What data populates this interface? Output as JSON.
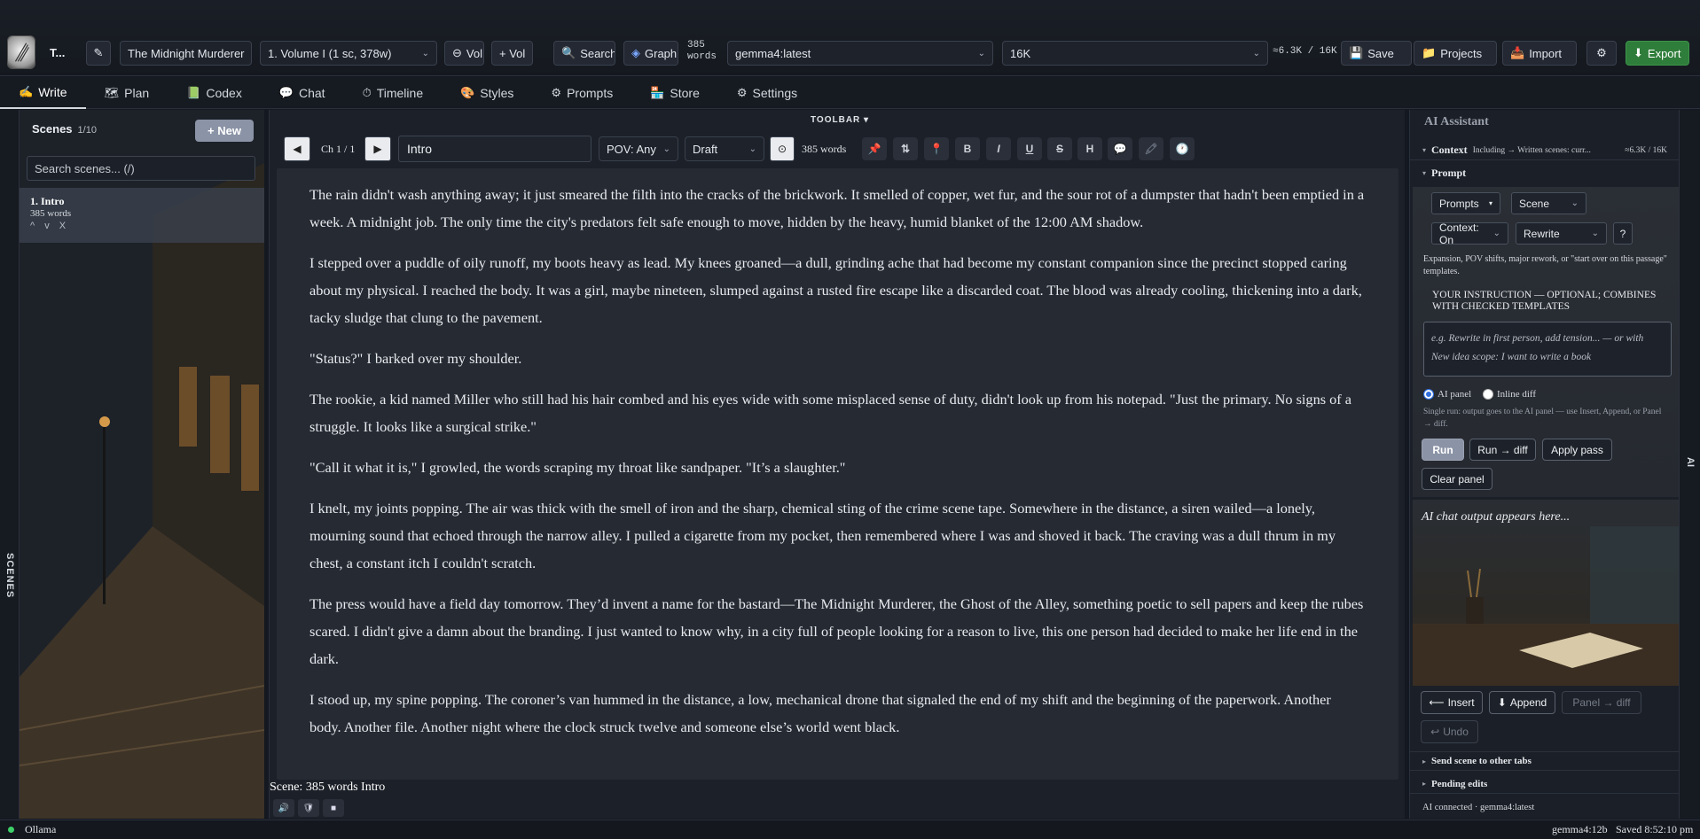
{
  "app": {
    "short_title": "T..."
  },
  "toolbar": {
    "project": "The Midnight Murderer",
    "volume": "1. Volume I (1 sc, 378w)",
    "vol_minus": "Vol",
    "vol_plus": "+ Vol",
    "search": "Search",
    "graph": "Graph",
    "word_count_number": "385",
    "word_count_unit": "words",
    "model": "gemma4:latest",
    "context_size": "16K",
    "token_usage": "≈6.3K / 16K",
    "save": "Save",
    "projects": "Projects",
    "import": "Import",
    "export": "Export"
  },
  "nav": {
    "tabs": [
      {
        "label": "Write",
        "icon": "✍"
      },
      {
        "label": "Plan",
        "icon": "🗺"
      },
      {
        "label": "Codex",
        "icon": "📗"
      },
      {
        "label": "Chat",
        "icon": "💬"
      },
      {
        "label": "Timeline",
        "icon": "⏱"
      },
      {
        "label": "Styles",
        "icon": "🎨"
      },
      {
        "label": "Prompts",
        "icon": "⚙"
      },
      {
        "label": "Store",
        "icon": "🏪"
      },
      {
        "label": "Settings",
        "icon": "⚙"
      }
    ]
  },
  "scenes": {
    "rail_label": "SCENES",
    "title": "Scenes",
    "count": "1/10",
    "new_button": "+ New",
    "search_placeholder": "Search scenes... (/)",
    "items": [
      {
        "title": "1. Intro",
        "words": "385 words",
        "controls": "^ v X"
      }
    ]
  },
  "editor": {
    "toolbar_label": "TOOLBAR ▾",
    "chapter": "Ch 1 / 1",
    "scene_title": "Intro",
    "pov": "POV: Any",
    "status": "Draft",
    "word_count": "385 words",
    "format_buttons": [
      "B",
      "I",
      "U",
      "S",
      "H"
    ],
    "paragraphs": [
      "The rain didn't wash anything away; it just smeared the filth into the cracks of the brickwork. It smelled of copper, wet fur, and the sour rot of a dumpster that hadn't been emptied in a week. A midnight job. The only time the city's predators felt safe enough to move, hidden by the heavy, humid blanket of the 12:00 AM shadow.",
      "I stepped over a puddle of oily runoff, my boots heavy as lead. My knees groaned—a dull, grinding ache that had become my constant companion since the precinct stopped caring about my physical. I reached the body. It was a girl, maybe nineteen, slumped against a rusted fire escape like a discarded coat. The blood was already cooling, thickening into a dark, tacky sludge that clung to the pavement.",
      "\"Status?\" I barked over my shoulder.",
      "The rookie, a kid named Miller who still had his hair combed and his eyes wide with some misplaced sense of duty, didn't look up from his notepad. \"Just the primary. No signs of a struggle. It looks like a surgical strike.\"",
      "\"Call it what it is,\" I growled, the words scraping my throat like sandpaper. \"It’s a slaughter.\"",
      "I knelt, my joints popping. The air was thick with the smell of iron and the sharp, chemical sting of the crime scene tape. Somewhere in the distance, a siren wailed—a lonely, mourning sound that echoed through the narrow alley. I pulled a cigarette from my pocket, then remembered where I was and shoved it back. The craving was a dull thrum in my chest, a constant itch I couldn't scratch.",
      "The press would have a field day tomorrow. They’d invent a name for the bastard—The Midnight Murderer, the Ghost of the Alley, something poetic to sell papers and keep the rubes scared. I didn't give a damn about the branding. I just wanted to know why, in a city full of people looking for a reason to live, this one person had decided to make her life end in the dark.",
      "I stood up, my spine popping. The coroner’s van hummed in the distance, a low, mechanical drone that signaled the end of my shift and the beginning of the paperwork. Another body. Another file. Another night where the clock struck twelve and someone else’s world went black."
    ],
    "status_line": "Scene: 385 words Intro"
  },
  "ai": {
    "rail_label": "AI",
    "title": "AI Assistant",
    "context_label": "Context",
    "context_detail": "Including → Written scenes: curr...",
    "context_usage": "≈6.3K / 16K",
    "prompt_label": "Prompt",
    "prompts_select": "Prompts",
    "scene_select": "Scene",
    "context_select": "Context: On",
    "mode_select": "Rewrite",
    "help": "?",
    "template_note": "Expansion, POV shifts, major rework, or \"start over on this passage\" templates.",
    "instruction_label": "YOUR INSTRUCTION — OPTIONAL; COMBINES WITH CHECKED TEMPLATES",
    "instruction_placeholder": "e.g. Rewrite in first person, add tension... — or with New idea scope: I want to write a book",
    "radio_panel": "AI panel",
    "radio_inline": "Inline diff",
    "run_note": "Single run: output goes to the AI panel — use Insert, Append, or Panel → diff.",
    "run": "Run",
    "run_diff": "Run → diff",
    "apply_pass": "Apply pass",
    "clear_panel": "Clear panel",
    "output_placeholder": "AI chat output appears here...",
    "insert": "Insert",
    "append": "Append",
    "panel_diff": "Panel → diff",
    "undo": "Undo",
    "send_scene": "Send scene to other tabs",
    "pending": "Pending edits",
    "connected": "AI connected · gemma4:latest"
  },
  "statusbar": {
    "provider": "Ollama",
    "model": "gemma4:12b",
    "saved": "Saved 8:52:10 pm"
  },
  "colors": {
    "accent_green": "#2f7d3a",
    "status_dot": "#3ed169",
    "run_button": "#8b93a6"
  }
}
